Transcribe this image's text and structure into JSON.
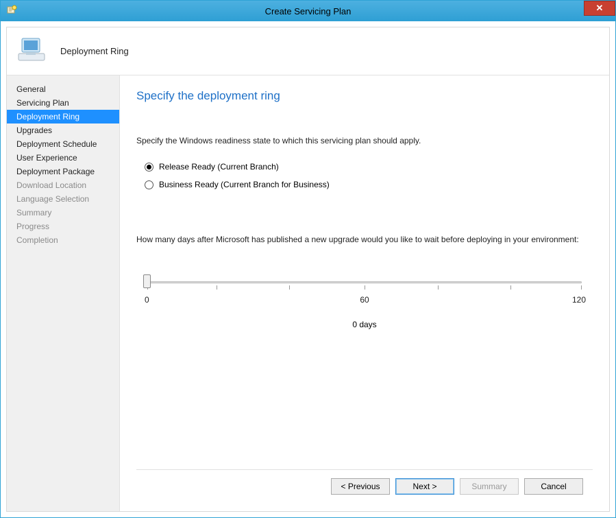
{
  "window": {
    "title": "Create Servicing Plan"
  },
  "header": {
    "label": "Deployment Ring"
  },
  "sidebar": {
    "items": [
      {
        "label": "General",
        "state": "normal"
      },
      {
        "label": "Servicing Plan",
        "state": "normal"
      },
      {
        "label": "Deployment Ring",
        "state": "selected"
      },
      {
        "label": "Upgrades",
        "state": "normal"
      },
      {
        "label": "Deployment Schedule",
        "state": "normal"
      },
      {
        "label": "User Experience",
        "state": "normal"
      },
      {
        "label": "Deployment Package",
        "state": "normal"
      },
      {
        "label": "Download Location",
        "state": "disabled"
      },
      {
        "label": "Language Selection",
        "state": "disabled"
      },
      {
        "label": "Summary",
        "state": "disabled"
      },
      {
        "label": "Progress",
        "state": "disabled"
      },
      {
        "label": "Completion",
        "state": "disabled"
      }
    ]
  },
  "content": {
    "title": "Specify the deployment ring",
    "description": "Specify the Windows readiness state to which this servicing plan should apply.",
    "options": [
      {
        "label": "Release Ready (Current Branch)",
        "selected": true
      },
      {
        "label": "Business Ready (Current Branch for Business)",
        "selected": false
      }
    ],
    "slider_caption": "How many days after Microsoft has published a new upgrade would you like to wait before deploying in your environment:",
    "slider": {
      "min_label": "0",
      "mid_label": "60",
      "max_label": "120",
      "value_label": "0 days"
    }
  },
  "footer": {
    "previous": "< Previous",
    "next": "Next >",
    "summary": "Summary",
    "cancel": "Cancel"
  }
}
